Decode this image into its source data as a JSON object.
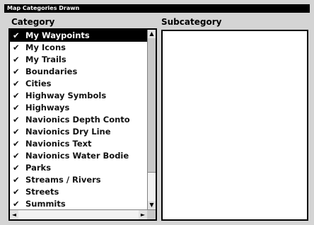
{
  "window": {
    "title": "Map Categories Drawn"
  },
  "category": {
    "label": "Category",
    "items": [
      {
        "check": "✔",
        "label": "My Waypoints",
        "selected": true
      },
      {
        "check": "✔",
        "label": "My Icons"
      },
      {
        "check": "✔",
        "label": "My Trails"
      },
      {
        "check": "✔",
        "label": "Boundaries"
      },
      {
        "check": "✔",
        "label": "Cities"
      },
      {
        "check": "✔",
        "label": "Highway Symbols"
      },
      {
        "check": "✔",
        "label": "Highways"
      },
      {
        "check": "✔",
        "label": "Navionics Depth Conto"
      },
      {
        "check": "✔",
        "label": "Navionics Dry Line"
      },
      {
        "check": "✔",
        "label": "Navionics Text"
      },
      {
        "check": "✔",
        "label": "Navionics Water Bodie"
      },
      {
        "check": "✔",
        "label": "Parks"
      },
      {
        "check": "✔",
        "label": "Streams / Rivers"
      },
      {
        "check": "✔",
        "label": "Streets"
      },
      {
        "check": "✔",
        "label": "Summits"
      }
    ],
    "scroll_up_icon": "▲",
    "scroll_down_icon": "▼",
    "scroll_left_icon": "◄",
    "scroll_right_icon": "►"
  },
  "subcategory": {
    "label": "Subcategory",
    "items": []
  }
}
